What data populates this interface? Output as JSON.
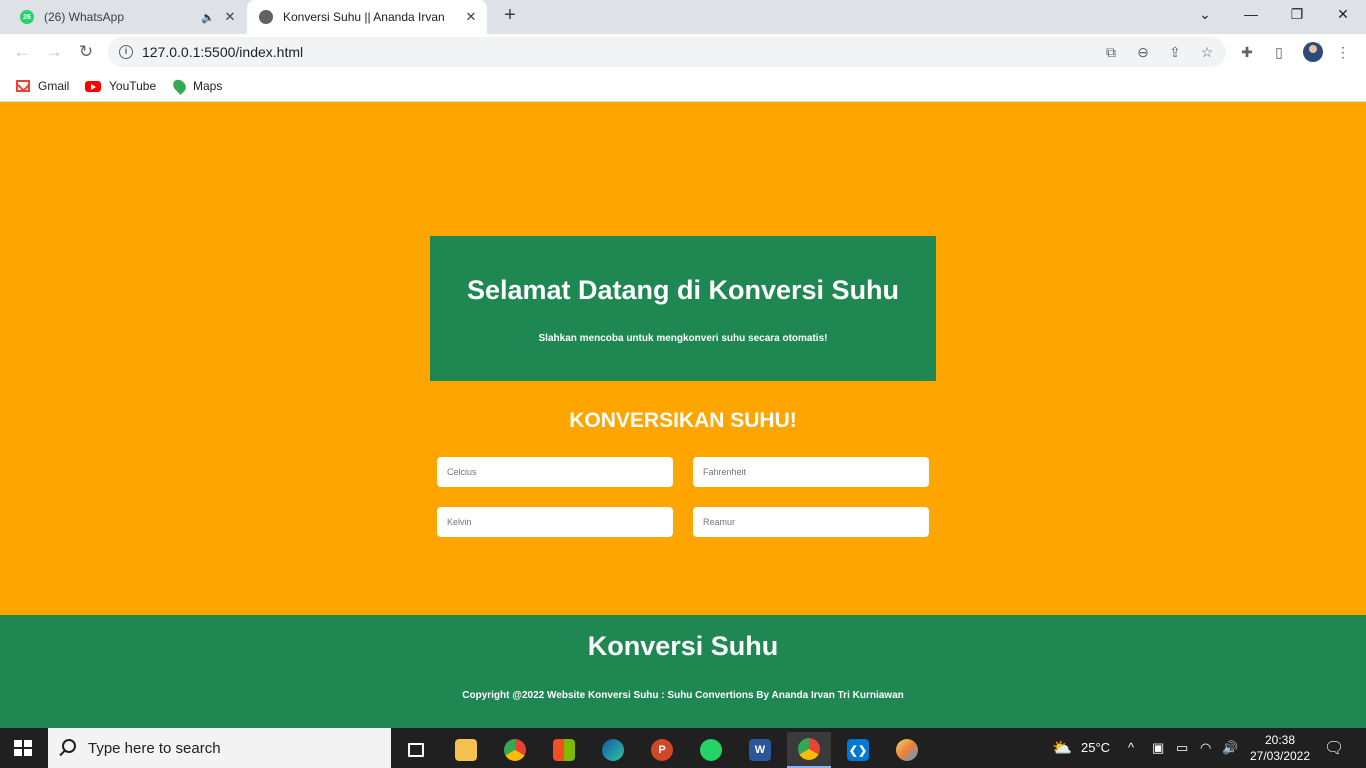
{
  "browser": {
    "tabs": [
      {
        "label": "(26) WhatsApp",
        "badge": "26",
        "icon": "whatsapp-icon",
        "audio": "speaker-icon"
      },
      {
        "label": "Konversi Suhu || Ananda Irvan",
        "icon": "globe-icon"
      }
    ],
    "url": "127.0.0.1:5500/index.html",
    "bookmarks": [
      {
        "label": "Gmail",
        "icon": "gmail-icon"
      },
      {
        "label": "YouTube",
        "icon": "youtube-icon"
      },
      {
        "label": "Maps",
        "icon": "maps-icon"
      }
    ]
  },
  "page": {
    "hero_title": "Selamat Datang di Konversi Suhu",
    "hero_subtitle": "Slahkan mencoba untuk mengkonveri suhu secara otomatis!",
    "section_title": "KONVERSIKAN SUHU!",
    "inputs": {
      "celcius_placeholder": "Celcius",
      "fahrenheit_placeholder": "Fahrenheit",
      "kelvin_placeholder": "Kelvin",
      "reamur_placeholder": "Reamur"
    },
    "footer_title": "Konversi Suhu",
    "footer_copyright": "Copyright @2022 Website Konversi Suhu : Suhu Convertions By Ananda Irvan Tri Kurniawan"
  },
  "colors": {
    "page_background": "#ffa500",
    "brand_green": "#1e8752"
  },
  "taskbar": {
    "search_placeholder": "Type here to search",
    "temperature": "25°C",
    "time": "20:38",
    "date": "27/03/2022"
  }
}
